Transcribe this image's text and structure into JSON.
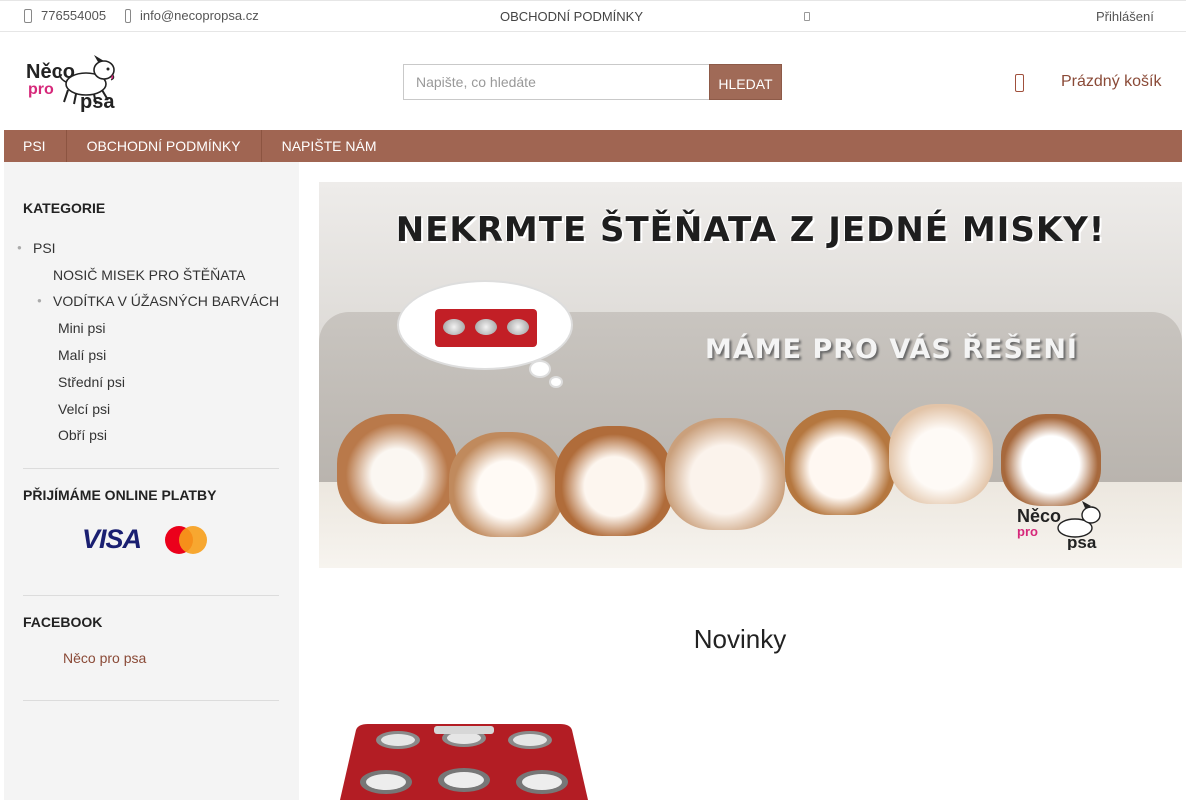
{
  "topbar": {
    "phone": "776554005",
    "email": "info@necopropsa.cz",
    "terms_link": "OBCHODNÍ PODMÍNKY",
    "login": "Přihlášení"
  },
  "header": {
    "logo_text": [
      "Něco",
      "pro",
      "psa"
    ],
    "search_placeholder": "Napište, co hledáte",
    "search_button": "HLEDAT",
    "cart_label": "Prázdný košík"
  },
  "nav": {
    "items": [
      {
        "label": "PSI"
      },
      {
        "label": "OBCHODNÍ PODMÍNKY"
      },
      {
        "label": "NAPIŠTE NÁM"
      }
    ]
  },
  "sidebar": {
    "categories_title": "KATEGORIE",
    "categories": [
      {
        "label": "PSI"
      },
      {
        "label": "NOSIČ MISEK PRO ŠTĚŇATA"
      },
      {
        "label": "VODÍTKA V ÚŽASNÝCH BARVÁCH"
      },
      {
        "label": "Mini psi"
      },
      {
        "label": "Malí psi"
      },
      {
        "label": "Střední psi"
      },
      {
        "label": "Velcí psi"
      },
      {
        "label": "Obří psi"
      }
    ],
    "payments_title": "PŘIJÍMÁME ONLINE PLATBY",
    "visa_label": "VISA",
    "facebook_title": "FACEBOOK",
    "facebook_link": "Něco pro psa"
  },
  "banner": {
    "headline": "NEKRMTE ŠTĚŇATA Z JEDNÉ MISKY!",
    "subline": "MÁME PRO VÁS ŘEŠENÍ"
  },
  "main": {
    "section_title": "Novinky"
  },
  "colors": {
    "accent": "#a06552",
    "link": "#8a4a37",
    "product_red": "#c21f26"
  }
}
